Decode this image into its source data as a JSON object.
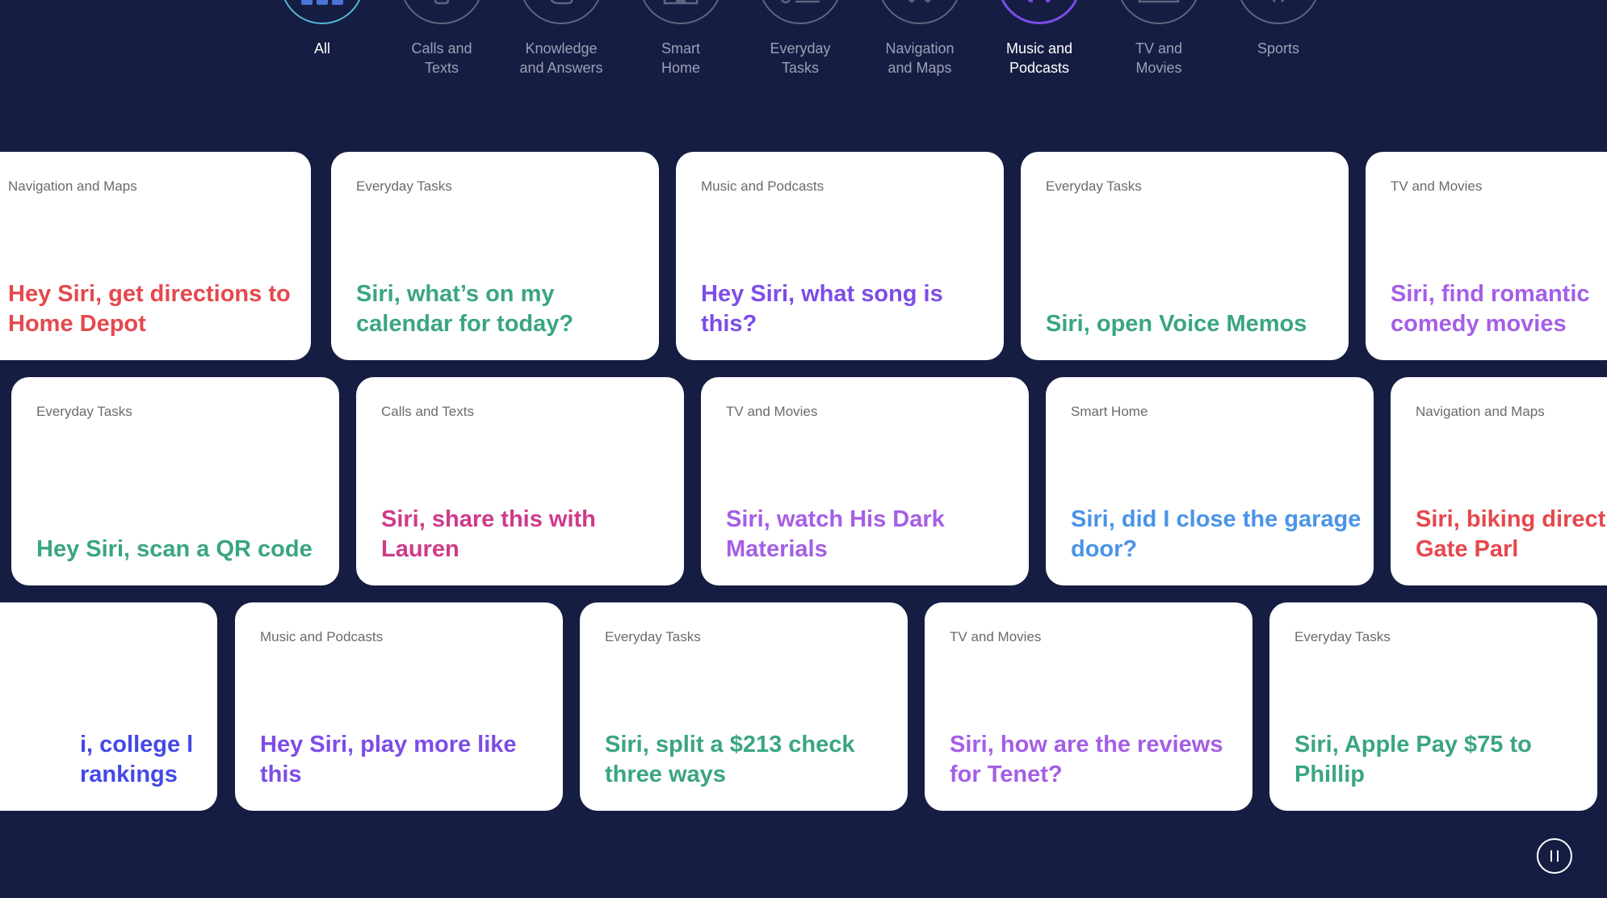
{
  "colors": {
    "background": "#161d42",
    "card_background": "#ffffff",
    "category_text": "#6a6a70",
    "navigation_maps": "#e5484d",
    "everyday_tasks": "#3aa583",
    "music_podcasts": "#7d4ce8",
    "tv_movies": "#a55ee6",
    "calls_texts": "#cf3a8a",
    "smart_home": "#4a94e8",
    "knowledge_answers": "#4348e8",
    "filter_active_ring": "#7b4de8",
    "filter_all_ring": "#4fb7d8"
  },
  "filters": [
    {
      "label": "All",
      "icon": "grid-bars-icon"
    },
    {
      "label": "Calls and\nTexts",
      "icon": "phone-icon"
    },
    {
      "label": "Knowledge\nand Answers",
      "icon": "hand-icon"
    },
    {
      "label": "Smart\nHome",
      "icon": "house-icon"
    },
    {
      "label": "Everyday\nTasks",
      "icon": "checklist-icon"
    },
    {
      "label": "Navigation\nand Maps",
      "icon": "map-icon"
    },
    {
      "label": "Music and\nPodcasts",
      "icon": "headphones-icon"
    },
    {
      "label": "TV and\nMovies",
      "icon": "tv-icon"
    },
    {
      "label": "Sports",
      "icon": "sports-icon"
    }
  ],
  "active_filter": "Music and Podcasts",
  "rows": [
    [
      {
        "category": "Navigation and Maps",
        "phrase": "Hey Siri, get directions to Home Depot"
      },
      {
        "category": "Everyday Tasks",
        "phrase": "Siri, what’s on my calendar for today?"
      },
      {
        "category": "Music and Podcasts",
        "phrase": "Hey Siri, what song is this?"
      },
      {
        "category": "Everyday Tasks",
        "phrase": "Siri, open Voice Memos"
      },
      {
        "category": "TV and Movies",
        "phrase": "Siri, find romantic comedy movies"
      }
    ],
    [
      {
        "category": "Everyday Tasks",
        "phrase": "Hey Siri, scan a QR code"
      },
      {
        "category": "Calls and Texts",
        "phrase": "Siri, share this with Lauren"
      },
      {
        "category": "TV and Movies",
        "phrase": "Siri, watch His Dark Materials"
      },
      {
        "category": "Smart Home",
        "phrase": "Siri, did I close the garage door?"
      },
      {
        "category": "Navigation and Maps",
        "phrase": "Siri, biking direct Golden Gate Parl"
      }
    ],
    [
      {
        "category": "",
        "phrase": "i, college l rankings"
      },
      {
        "category": "Music and Podcasts",
        "phrase": "Hey Siri, play more like this"
      },
      {
        "category": "Everyday Tasks",
        "phrase": "Siri, split a $213 check three ways"
      },
      {
        "category": "TV and Movies",
        "phrase": "Siri, how are the reviews for Tenet?"
      },
      {
        "category": "Everyday Tasks",
        "phrase": "Siri, Apple Pay $75 to Phillip"
      }
    ]
  ],
  "pause_button": {
    "icon": "pause-icon"
  }
}
